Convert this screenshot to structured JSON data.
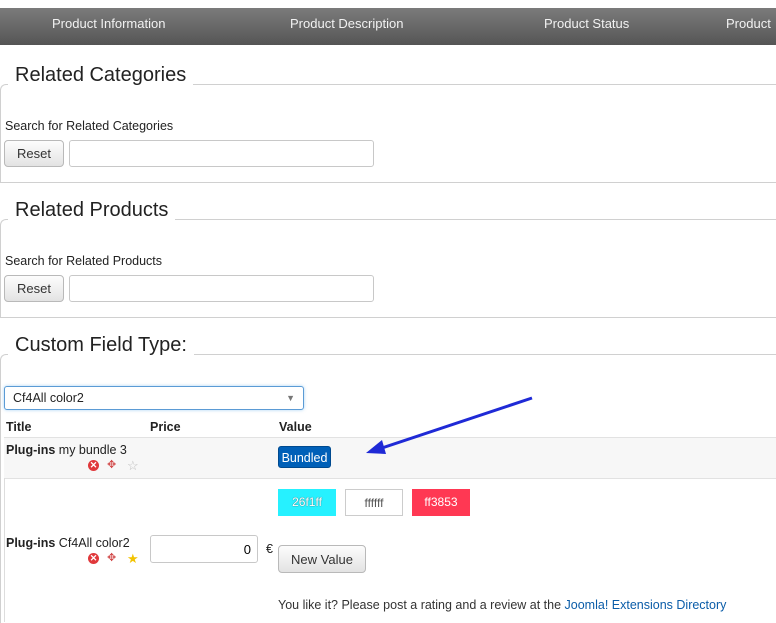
{
  "tabs": [
    "Product Information",
    "Product Description",
    "Product Status",
    "Product"
  ],
  "related_categories": {
    "legend": "Related Categories",
    "search_label": "Search for Related Categories",
    "reset_label": "Reset",
    "input_value": ""
  },
  "related_products": {
    "legend": "Related Products",
    "search_label": "Search for Related Products",
    "reset_label": "Reset",
    "input_value": ""
  },
  "custom_field": {
    "legend": "Custom Field Type:",
    "select_value": "Cf4All color2",
    "columns": [
      "Title",
      "Price",
      "Value"
    ],
    "rows": [
      {
        "title_bold": "Plug-ins",
        "title_rest": " my bundle 3",
        "value_badge": "Bundled"
      },
      {
        "title_bold": "Plug-ins",
        "title_rest": " Cf4All color2",
        "price": "0",
        "currency": "€",
        "swatches": [
          {
            "label": "26f1ff",
            "color": "#26f1ff"
          },
          {
            "label": "ffffff",
            "color": "#ffffff"
          },
          {
            "label": "ff3853",
            "color": "#ff3853"
          }
        ],
        "new_value_label": "New Value"
      }
    ],
    "footer_text": "You like it? Please post a rating and a review at the ",
    "footer_link": "Joomla! Extensions Directory"
  },
  "colors": {
    "arrow": "#1f2ad6",
    "badge": "#0060b8"
  },
  "icons": [
    "delete-icon",
    "move-icon",
    "star-icon"
  ]
}
